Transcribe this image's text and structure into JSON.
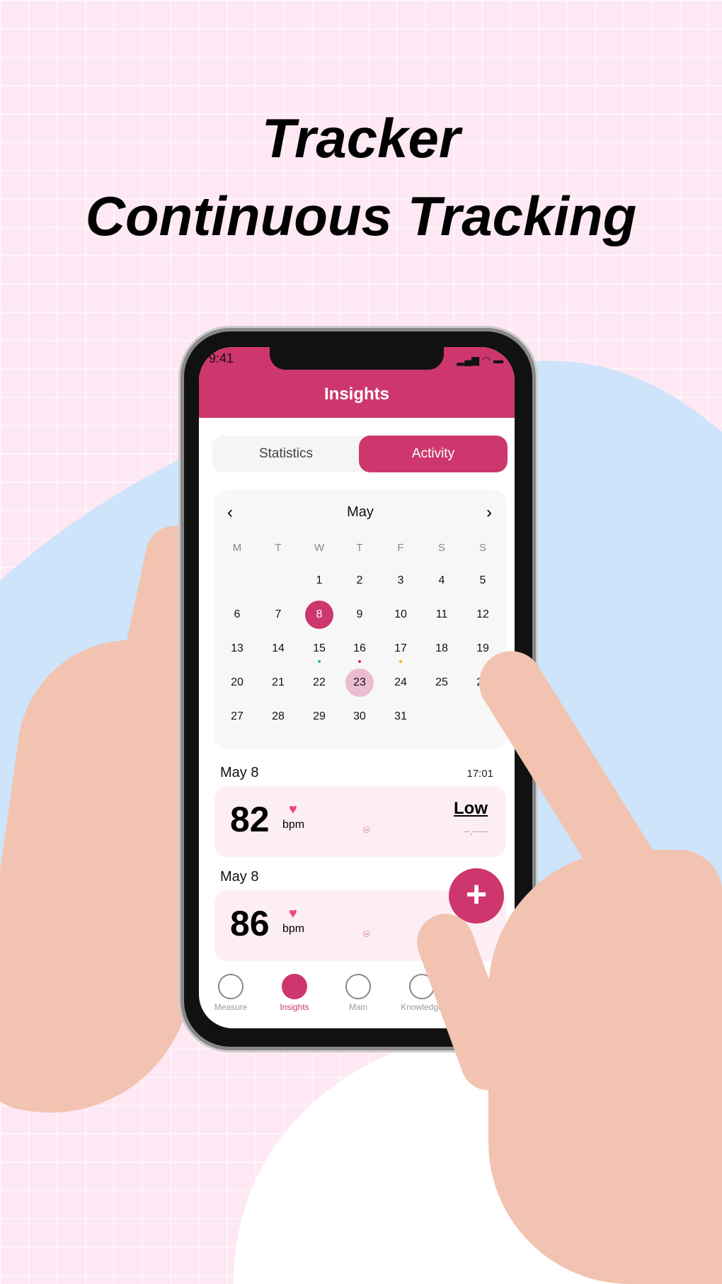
{
  "headline": {
    "line1": "Tracker",
    "line2": "Continuous Tracking"
  },
  "colors": {
    "accent": "#cd376d",
    "card_bg": "#fdeef5",
    "background": "#fde8f3",
    "blob": "#cde4fb"
  },
  "status_bar": {
    "time": "9:41"
  },
  "header": {
    "title": "Insights"
  },
  "tabs": [
    {
      "label": "Statistics",
      "active": false
    },
    {
      "label": "Activity",
      "active": true
    }
  ],
  "calendar": {
    "month": "May",
    "prev_icon": "chevron-left-icon",
    "next_icon": "chevron-right-icon",
    "weekdays": [
      "M",
      "T",
      "W",
      "T",
      "F",
      "S",
      "S"
    ],
    "first_weekday_index": 2,
    "days_in_month": 31,
    "selected_day": "8",
    "highlighted_day": "23",
    "dots": [
      {
        "day": "15",
        "color": "#22cc66"
      },
      {
        "day": "16",
        "color": "#ee2244"
      },
      {
        "day": "17",
        "color": "#f2b800"
      }
    ]
  },
  "records": [
    {
      "date": "May 8",
      "time": "17:01",
      "value": "82",
      "unit": "bpm",
      "status": "Low",
      "location": "--,-----"
    },
    {
      "date": "May 8",
      "value": "86",
      "unit": "bpm",
      "location": "--,"
    }
  ],
  "fab": {
    "label": "+"
  },
  "nav": [
    {
      "label": "Measure",
      "icon": "heart-pulse-icon"
    },
    {
      "label": "Insights",
      "icon": "bar-chart-icon",
      "active": true
    },
    {
      "label": "Main",
      "icon": "grid-icon"
    },
    {
      "label": "Knowledge",
      "icon": "globe-icon"
    }
  ]
}
